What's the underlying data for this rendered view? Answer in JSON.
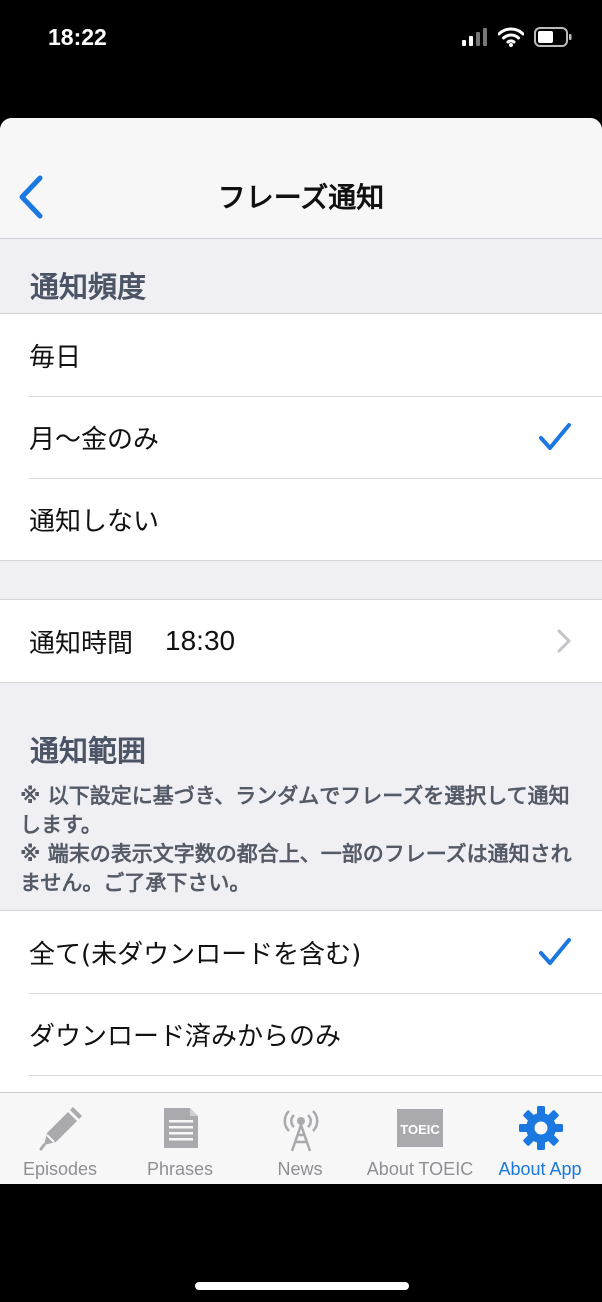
{
  "status_bar": {
    "time": "18:22"
  },
  "nav": {
    "title": "フレーズ通知"
  },
  "frequency": {
    "header": "通知頻度",
    "options": [
      {
        "label": "毎日",
        "checked": false
      },
      {
        "label": "月〜金のみ",
        "checked": true
      },
      {
        "label": "通知しない",
        "checked": false
      }
    ]
  },
  "time": {
    "label": "通知時間",
    "value": "18:30"
  },
  "range": {
    "header": "通知範囲",
    "note1": "※ 以下設定に基づき、ランダムでフレーズを選択して通知します。",
    "note2": "※ 端末の表示文字数の都合上、一部のフレーズは通知されません。ご了承下さい。",
    "options": [
      {
        "label": "全て(未ダウンロードを含む)",
        "checked": true
      },
      {
        "label": "ダウンロード済みからのみ",
        "checked": false
      }
    ]
  },
  "tabs": [
    {
      "label": "Episodes",
      "active": false
    },
    {
      "label": "Phrases",
      "active": false
    },
    {
      "label": "News",
      "active": false
    },
    {
      "label": "About TOEIC",
      "icon_text": "TOEIC",
      "active": false
    },
    {
      "label": "About App",
      "active": true
    }
  ],
  "colors": {
    "accent": "#1a78e0",
    "inactive": "#8e8e93",
    "background": "#efeff4"
  }
}
